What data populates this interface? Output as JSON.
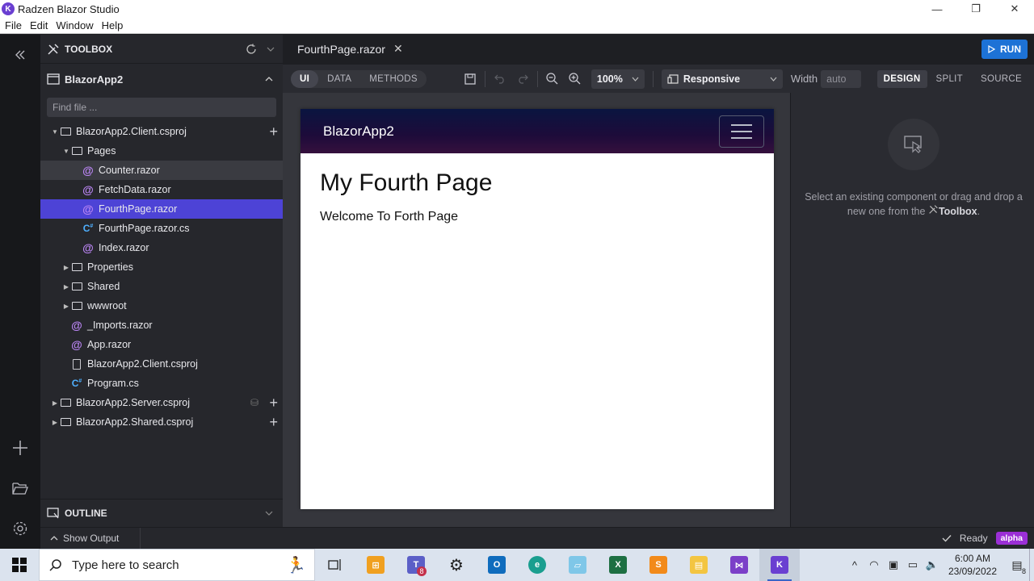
{
  "window": {
    "title": "Radzen Blazor Studio",
    "logo_letter": "K",
    "controls": {
      "minimize": "—",
      "restore": "❐",
      "close": "✕"
    }
  },
  "menubar": {
    "items": [
      "File",
      "Edit",
      "Window",
      "Help"
    ]
  },
  "sidebar": {
    "toolbox_title": "TOOLBOX",
    "project_name": "BlazorApp2",
    "search_placeholder": "Find file ...",
    "tree": [
      {
        "label": "BlazorApp2.Client.csproj",
        "indent": 0,
        "caret": "▼",
        "icon": "folder",
        "plus": true
      },
      {
        "label": "Pages",
        "indent": 1,
        "caret": "▼",
        "icon": "folder"
      },
      {
        "label": "Counter.razor",
        "indent": 2,
        "icon": "at",
        "state": "hover"
      },
      {
        "label": "FetchData.razor",
        "indent": 2,
        "icon": "at"
      },
      {
        "label": "FourthPage.razor",
        "indent": 2,
        "icon": "at",
        "state": "selected"
      },
      {
        "label": "FourthPage.razor.cs",
        "indent": 2,
        "icon": "cs"
      },
      {
        "label": "Index.razor",
        "indent": 2,
        "icon": "at"
      },
      {
        "label": "Properties",
        "indent": 1,
        "caret": "▶",
        "icon": "folder"
      },
      {
        "label": "Shared",
        "indent": 1,
        "caret": "▶",
        "icon": "folder"
      },
      {
        "label": "wwwroot",
        "indent": 1,
        "caret": "▶",
        "icon": "folder"
      },
      {
        "label": "_Imports.razor",
        "indent": 1,
        "icon": "at"
      },
      {
        "label": "App.razor",
        "indent": 1,
        "icon": "at"
      },
      {
        "label": "BlazorApp2.Client.csproj",
        "indent": 1,
        "icon": "file"
      },
      {
        "label": "Program.cs",
        "indent": 1,
        "icon": "cs"
      },
      {
        "label": "BlazorApp2.Server.csproj",
        "indent": 0,
        "caret": "▶",
        "icon": "folder",
        "plus": true,
        "db": true
      },
      {
        "label": "BlazorApp2.Shared.csproj",
        "indent": 0,
        "caret": "▶",
        "icon": "folder",
        "plus": true
      }
    ],
    "outline_title": "OUTLINE"
  },
  "status": {
    "show_output": "Show Output",
    "ready": "Ready",
    "badge": "alpha"
  },
  "editor": {
    "tab_label": "FourthPage.razor",
    "run_label": "RUN",
    "modes": [
      "UI",
      "DATA",
      "METHODS"
    ],
    "active_mode": "UI",
    "zoom": "100%",
    "device": "Responsive",
    "width_label": "Width",
    "width_value": "auto",
    "views": [
      "DESIGN",
      "SPLIT",
      "SOURCE"
    ],
    "active_view": "DESIGN"
  },
  "preview": {
    "brand": "BlazorApp2",
    "heading": "My Fourth Page",
    "paragraph": "Welcome To Forth Page"
  },
  "properties": {
    "hint_prefix": "Select an existing component or drag and drop a new one from the",
    "hint_link": "Toolbox",
    "hint_suffix": "."
  },
  "taskbar": {
    "search_placeholder": "Type here to search",
    "teams_badge": "8",
    "time": "6:00 AM",
    "date": "23/09/2022",
    "notifications": "8"
  },
  "colors": {
    "accent": "#4d43d6",
    "run": "#1d72d6",
    "alpha_badge": "#9b2fd6",
    "razor_icon": "#b985f2",
    "cs_icon": "#4fb0ff"
  }
}
